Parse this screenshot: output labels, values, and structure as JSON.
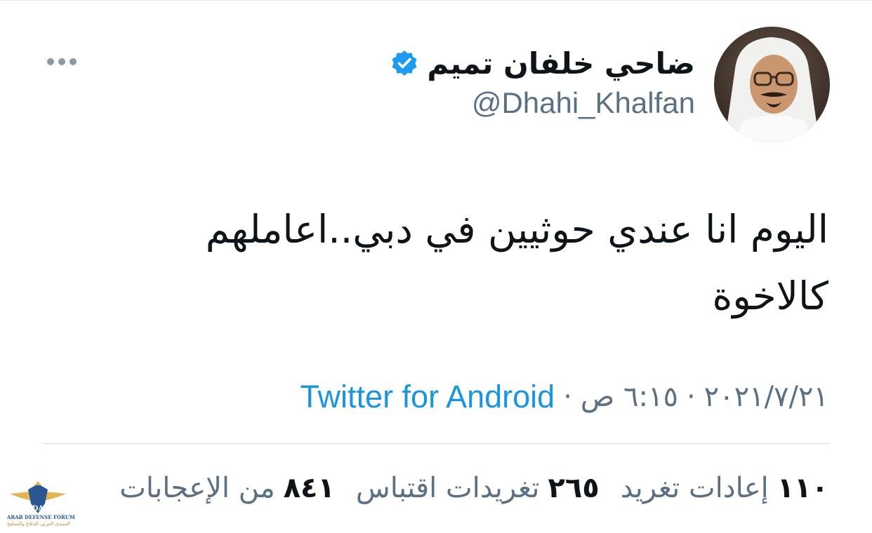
{
  "tweet": {
    "author": {
      "display_name": "ضاحي خلفان تميم",
      "handle": "@Dhahi_Khalfan",
      "verified": true,
      "avatar_icon": "profile-photo"
    },
    "text_line1": "اليوم انا عندي حوثيين في دبي..اعاملهم",
    "text_line2": "كالاخوة",
    "date": "٢٠٢١/٧/٢١",
    "time": "٦:١٥ ص",
    "separator": "·",
    "source": "Twitter for Android",
    "stats": {
      "retweets_count": "١١٠",
      "retweets_label": "إعادات تغريد",
      "quotes_count": "٢٦٥",
      "quotes_label": "تغريدات اقتباس",
      "likes_count": "٨٤١",
      "likes_label": "من الإعجابات"
    },
    "more_icon": "more-horizontal-icon"
  },
  "watermark": {
    "logo_text": "DA",
    "name_en": "ARAB DEFENSE FORUM",
    "name_ar": "المنتدى العربي للدفاع والتسليح"
  },
  "colors": {
    "text_primary": "#0f1419",
    "text_secondary": "#5b7083",
    "link": "#1b95e0",
    "verified": "#1d9bf0",
    "divider": "#d9d9d9"
  }
}
